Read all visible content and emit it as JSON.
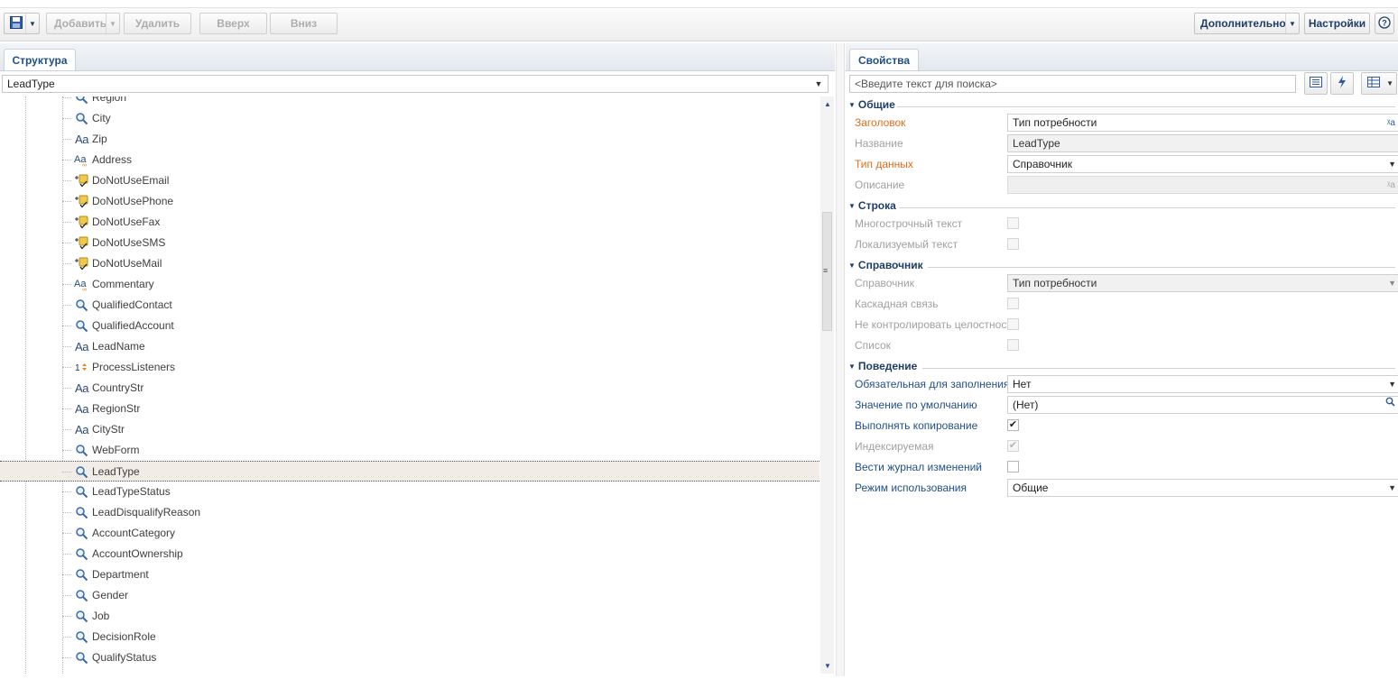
{
  "toolbar": {
    "add_label": "Добавить",
    "delete_label": "Удалить",
    "up_label": "Вверх",
    "down_label": "Вниз",
    "additional_label": "Дополнительно",
    "settings_label": "Настройки"
  },
  "left_panel": {
    "tab_label": "Структура",
    "selected_object": "LeadType",
    "tree_items": [
      {
        "label": "Region",
        "icon": "lookup-icon"
      },
      {
        "label": "City",
        "icon": "lookup-icon"
      },
      {
        "label": "Zip",
        "icon": "text-icon"
      },
      {
        "label": "Address",
        "icon": "multiline-text-icon"
      },
      {
        "label": "DoNotUseEmail",
        "icon": "boolean-icon"
      },
      {
        "label": "DoNotUsePhone",
        "icon": "boolean-icon"
      },
      {
        "label": "DoNotUseFax",
        "icon": "boolean-icon"
      },
      {
        "label": "DoNotUseSMS",
        "icon": "boolean-icon"
      },
      {
        "label": "DoNotUseMail",
        "icon": "boolean-icon"
      },
      {
        "label": "Commentary",
        "icon": "multiline-text-icon"
      },
      {
        "label": "QualifiedContact",
        "icon": "lookup-icon"
      },
      {
        "label": "QualifiedAccount",
        "icon": "lookup-icon"
      },
      {
        "label": "LeadName",
        "icon": "text-icon"
      },
      {
        "label": "ProcessListeners",
        "icon": "integer-icon"
      },
      {
        "label": "CountryStr",
        "icon": "text-icon"
      },
      {
        "label": "RegionStr",
        "icon": "text-icon"
      },
      {
        "label": "CityStr",
        "icon": "text-icon"
      },
      {
        "label": "WebForm",
        "icon": "lookup-icon"
      },
      {
        "label": "LeadType",
        "icon": "lookup-icon",
        "selected": true
      },
      {
        "label": "LeadTypeStatus",
        "icon": "lookup-icon"
      },
      {
        "label": "LeadDisqualifyReason",
        "icon": "lookup-icon"
      },
      {
        "label": "AccountCategory",
        "icon": "lookup-icon"
      },
      {
        "label": "AccountOwnership",
        "icon": "lookup-icon"
      },
      {
        "label": "Department",
        "icon": "lookup-icon"
      },
      {
        "label": "Gender",
        "icon": "lookup-icon"
      },
      {
        "label": "Job",
        "icon": "lookup-icon"
      },
      {
        "label": "DecisionRole",
        "icon": "lookup-icon"
      },
      {
        "label": "QualifyStatus",
        "icon": "lookup-icon"
      }
    ]
  },
  "right_panel": {
    "tab_label": "Свойства",
    "search_placeholder": "<Введите текст для поиска>",
    "groups": {
      "general": "Общие",
      "string": "Строка",
      "lookup": "Справочник",
      "behavior": "Поведение"
    },
    "props": {
      "caption_label": "Заголовок",
      "caption_value": "Тип потребности",
      "name_label": "Название",
      "name_value": "LeadType",
      "datatype_label": "Тип данных",
      "datatype_value": "Справочник",
      "description_label": "Описание",
      "multiline_label": "Многострочный текст",
      "localizable_label": "Локализуемый текст",
      "lookup_label": "Справочник",
      "lookup_value": "Тип потребности",
      "cascade_label": "Каскадная связь",
      "no_integrity_label": "Не контролировать целостность",
      "list_label": "Список",
      "required_label": "Обязательная для заполнения",
      "required_value": "Нет",
      "default_label": "Значение по умолчанию",
      "default_value": "(Нет)",
      "copy_label": "Выполнять копирование",
      "copy_checked": true,
      "indexed_label": "Индексируемая",
      "indexed_checked": true,
      "changelog_label": "Вести журнал изменений",
      "changelog_checked": false,
      "usage_label": "Режим использования",
      "usage_value": "Общие"
    }
  },
  "colors": {
    "accent_blue": "#1f4f86",
    "required_orange": "#e06e1e",
    "selection_bg": "#f1ece6"
  }
}
